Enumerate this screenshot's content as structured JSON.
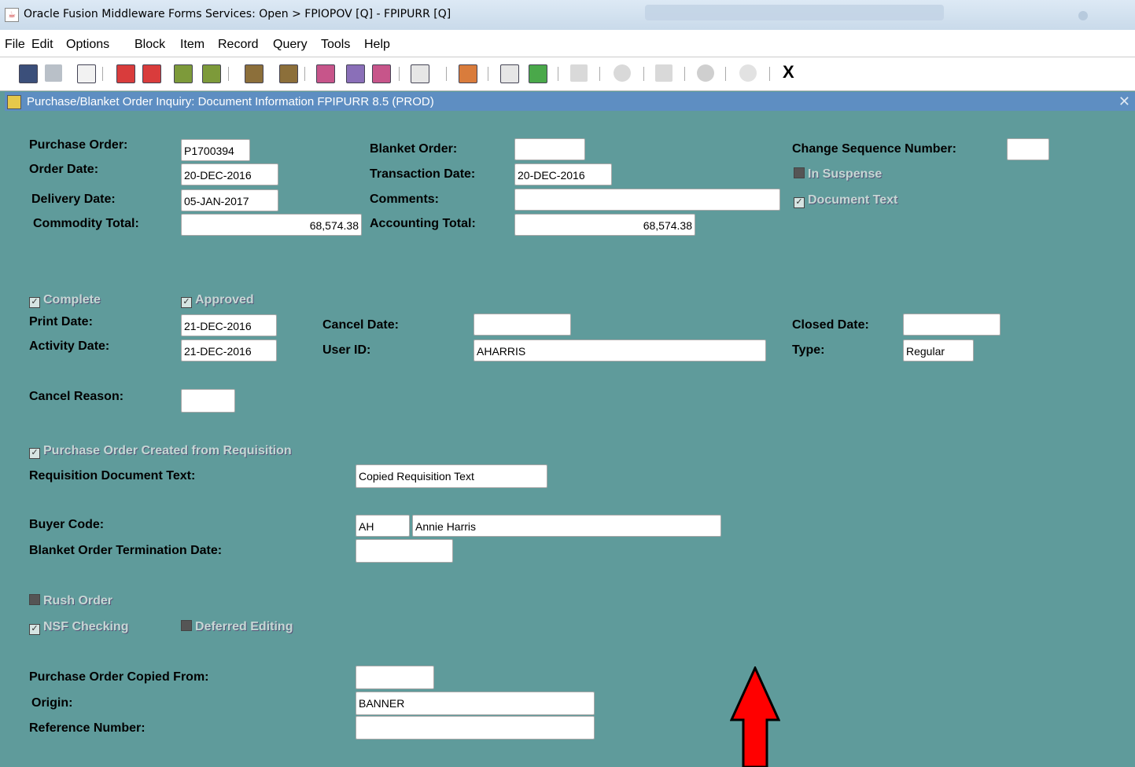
{
  "window": {
    "title": "Oracle Fusion Middleware Forms Services:  Open > FPIOPOV [Q] - FPIPURR [Q]"
  },
  "menu": [
    "File",
    "Edit",
    "Options",
    "Block",
    "Item",
    "Record",
    "Query",
    "Tools",
    "Help"
  ],
  "toolbar": {
    "exit_label": "X"
  },
  "form_title": "Purchase/Blanket Order Inquiry: Document Information  FPIPURR  8.5  (PROD)",
  "fields": {
    "purchase_order": {
      "label": "Purchase Order:",
      "value": "P1700394"
    },
    "order_date": {
      "label": "Order Date:",
      "value": "20-DEC-2016"
    },
    "delivery_date": {
      "label": "Delivery Date:",
      "value": "05-JAN-2017"
    },
    "commodity_total": {
      "label": "Commodity Total:",
      "value": "68,574.38"
    },
    "blanket_order": {
      "label": "Blanket Order:",
      "value": ""
    },
    "transaction_date": {
      "label": "Transaction Date:",
      "value": "20-DEC-2016"
    },
    "comments": {
      "label": "Comments:",
      "value": ""
    },
    "accounting_total": {
      "label": "Accounting Total:",
      "value": "68,574.38"
    },
    "change_sequence_number": {
      "label": "Change Sequence Number:",
      "value": ""
    },
    "print_date": {
      "label": "Print Date:",
      "value": "21-DEC-2016"
    },
    "activity_date": {
      "label": "Activity Date:",
      "value": "21-DEC-2016"
    },
    "cancel_date": {
      "label": "Cancel Date:",
      "value": ""
    },
    "user_id": {
      "label": "User ID:",
      "value": "AHARRIS"
    },
    "closed_date": {
      "label": "Closed Date:",
      "value": ""
    },
    "type": {
      "label": "Type:",
      "value": "Regular"
    },
    "cancel_reason": {
      "label": "Cancel Reason:",
      "value": ""
    },
    "requisition_document_text": {
      "label": "Requisition Document Text:",
      "value": "Copied Requisition Text"
    },
    "buyer_code": {
      "label": "Buyer Code:",
      "code": "AH",
      "name": "Annie Harris"
    },
    "blanket_termination_date": {
      "label": "Blanket Order Termination Date:",
      "value": ""
    },
    "po_copied_from": {
      "label": "Purchase Order Copied From:",
      "value": ""
    },
    "origin": {
      "label": "Origin:",
      "value": "BANNER"
    },
    "reference_number": {
      "label": "Reference Number:",
      "value": ""
    }
  },
  "checkboxes": {
    "in_suspense": {
      "label": "In Suspense",
      "checked": false
    },
    "document_text": {
      "label": "Document Text",
      "checked": true
    },
    "complete": {
      "label": "Complete",
      "checked": true
    },
    "approved": {
      "label": "Approved",
      "checked": true
    },
    "po_from_requisition": {
      "label": "Purchase Order Created from Requisition",
      "checked": true
    },
    "rush_order": {
      "label": "Rush Order",
      "checked": false
    },
    "nsf_checking": {
      "label": "NSF Checking",
      "checked": true
    },
    "deferred_editing": {
      "label": "Deferred Editing",
      "checked": false
    }
  },
  "colors": {
    "form_bg": "#5f9b9b",
    "header_bg": "#5e8ec2",
    "arrow": "#ff0000"
  }
}
